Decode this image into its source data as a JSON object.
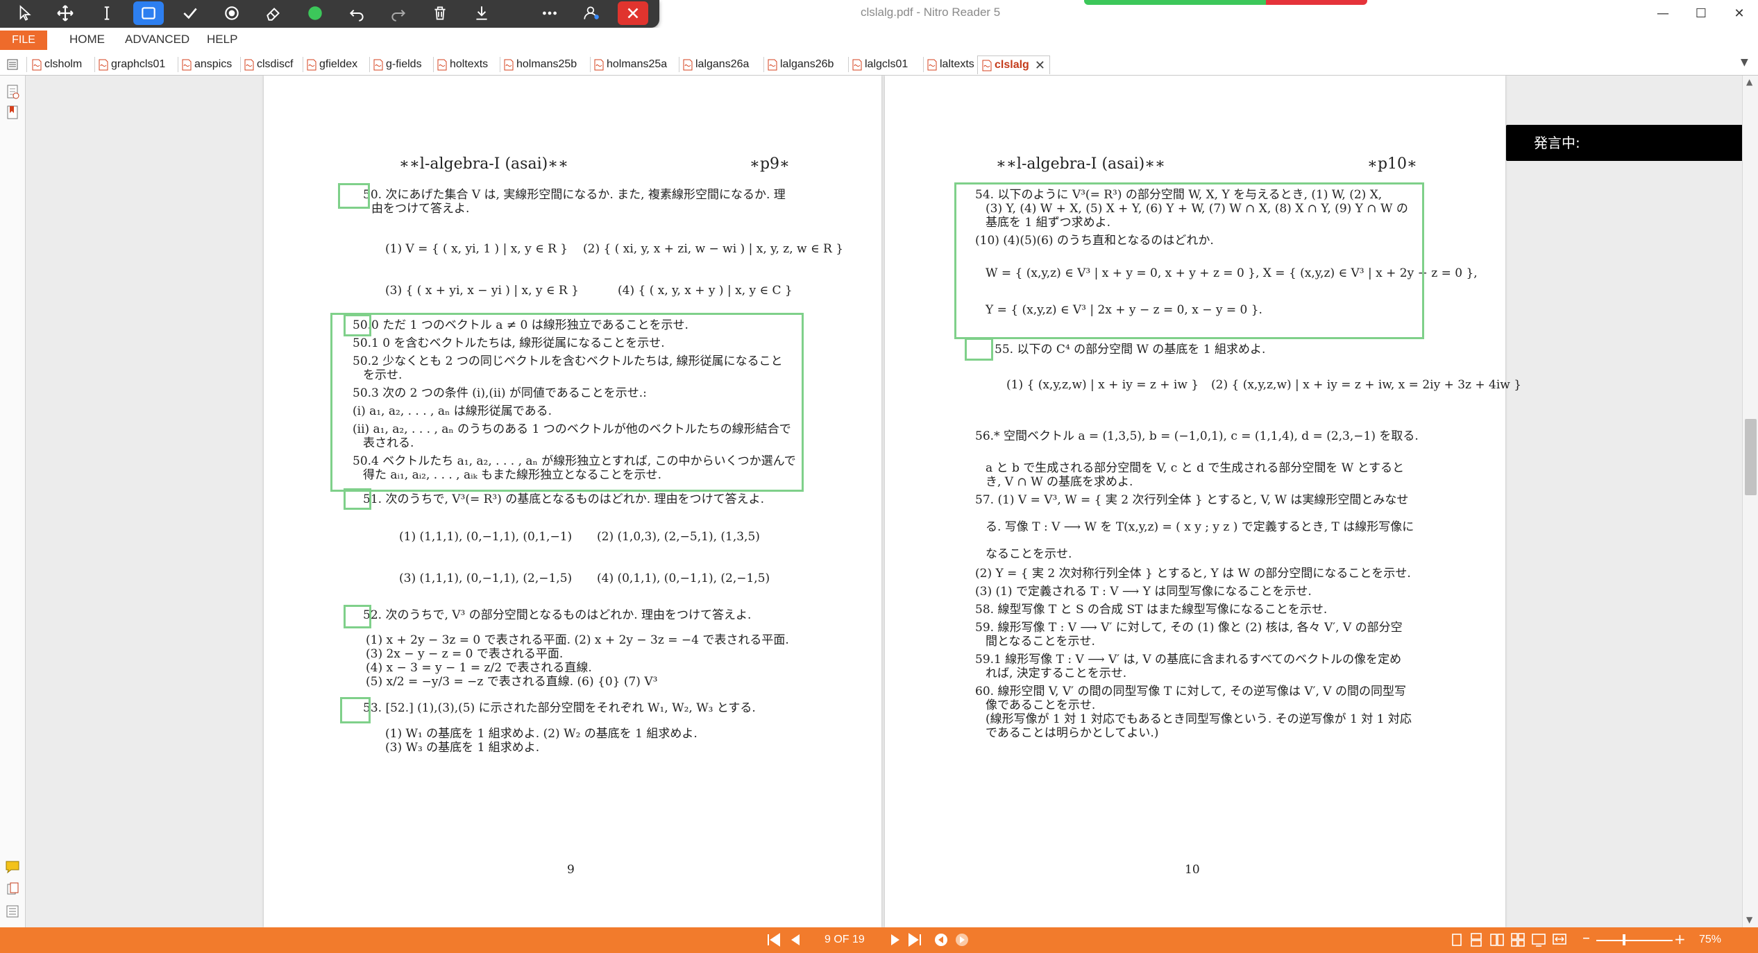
{
  "app": {
    "title": "clslalg.pdf - Nitro Reader 5"
  },
  "window": {
    "minimize": "—",
    "maximize": "☐",
    "close": "✕"
  },
  "ribbon": {
    "file": "FILE",
    "home": "HOME",
    "advanced": "ADVANCED",
    "help": "HELP"
  },
  "tabs": [
    "clsholm",
    "graphcls01",
    "anspics",
    "clsdiscf",
    "gfieldex",
    "g-fields",
    "holtexts",
    "holmans25b",
    "holmans25a",
    "lalgans26a",
    "lalgans26b",
    "lalgcls01",
    "laltexts",
    "clslalg"
  ],
  "tooltip": {
    "text": "発言中:"
  },
  "status": {
    "page_counter": "9 OF 19",
    "zoom": "75%"
  },
  "page9": {
    "header_left": "∗∗l-algebra-I (asai)∗∗",
    "header_right": "∗p9∗",
    "footer": "9",
    "lines": [
      "50. 次にあげた集合 V は, 実線形空間になるか. また, 複素線形空間になるか. 理",
      "由をつけて答えよ.",
      "(1) V = { ( x, yi, 1 ) | x, y ∈ R }",
      "(2) { ( xi, y, x + zi, w − wi ) | x, y, z, w ∈ R }",
      "(3) { ( x + yi, x − yi ) | x, y ∈ R }",
      "(4) { ( x, y, x + y ) | x, y ∈ C }",
      "50.0 ただ 1 つのベクトル a ≠ 0 は線形独立であることを示せ.",
      "50.1 0 を含むベクトルたちは, 線形従属になることを示せ.",
      "50.2 少なくとも 2 つの同じベクトルを含むベクトルたちは, 線形従属になること",
      "を示せ.",
      "50.3 次の 2 つの条件 (i),(ii) が同値であることを示せ.:",
      "(i) a₁, a₂, . . . , aₙ は線形従属である.",
      "(ii) a₁, a₂, . . . , aₙ のうちのある 1 つのベクトルが他のベクトルたちの線形結合で",
      "表される.",
      "50.4 ベクトルたち a₁, a₂, . . . , aₙ が線形独立とすれば, この中からいくつか選んで",
      "得た aᵢ₁, aᵢ₂, . . . , aᵢₖ もまた線形独立となることを示せ.",
      "51. 次のうちで, V³(= R³) の基底となるものはどれか. 理由をつけて答えよ.",
      "(1) (1,1,1), (0,−1,1), (0,1,−1)",
      "(2) (1,0,3), (2,−5,1), (1,3,5)",
      "(3) (1,1,1), (0,−1,1), (2,−1,5)",
      "(4) (0,1,1), (0,−1,1), (2,−1,5)",
      "52. 次のうちで, V³ の部分空間となるものはどれか. 理由をつけて答えよ.",
      "(1) x + 2y − 3z = 0 で表される平面.   (2) x + 2y − 3z = −4 で表される平面.",
      "(3) 2x − y − z = 0 で表される平面.",
      "(4) x − 3 = y − 1 = z/2 で表される直線.",
      "(5) x/2 = −y/3 = −z で表される直線.      (6) {0}      (7) V³",
      "53. [52.] (1),(3),(5) に示された部分空間をそれぞれ W₁, W₂, W₃ とする.",
      "(1) W₁ の基底を 1 組求めよ.                              (2) W₂ の基底を 1 組求めよ.",
      "(3) W₃ の基底を 1 組求めよ."
    ]
  },
  "page10": {
    "header_left": "∗∗l-algebra-I (asai)∗∗",
    "header_right": "∗p10∗",
    "footer": "10",
    "lines": [
      "54. 以下のように V³(= R³) の部分空間 W, X, Y を与えるとき, (1) W, (2) X,",
      "(3) Y, (4) W + X, (5) X + Y, (6) Y + W, (7) W ∩ X, (8) X ∩ Y, (9) Y ∩ W の",
      "基底を 1 組ずつ求めよ.",
      "(10) (4)(5)(6) のうち直和となるのはどれか.",
      "W = { (x,y,z) ∈ V³ | x + y = 0, x + y + z = 0 },  X = { (x,y,z) ∈ V³ | x + 2y − z = 0 },",
      "Y = { (x,y,z) ∈ V³ | 2x + y − z = 0, x − y = 0 }.",
      "55. 以下の C⁴ の部分空間 W の基底を 1 組求めよ.",
      "(1) { (x,y,z,w) | x + iy = z + iw }",
      "(2) { (x,y,z,w) | x + iy = z + iw, x = 2iy + 3z + 4iw }",
      "56.* 空間ベクトル a = (1,3,5), b = (−1,0,1), c = (1,1,4), d = (2,3,−1) を取る.",
      "a と b で生成される部分空間を V, c と d で生成される部分空間を W とすると",
      "き, V ∩ W の基底を求めよ.",
      "57. (1) V = V³, W = { 実 2 次行列全体 } とすると, V, W は実線形空間とみなせ",
      "る. 写像 T : V ⟶ W を T(x,y,z) = ( x y ; y z ) で定義するとき, T は線形写像に",
      "なることを示せ.",
      "(2) Y = { 実 2 次対称行列全体 } とすると, Y は W の部分空間になることを示せ.",
      "(3) (1) で定義される T : V ⟶ Y は同型写像になることを示せ.",
      "58. 線型写像 T と S の合成 ST はまた線型写像になることを示せ.",
      "59. 線形写像 T : V ⟶ V′ に対して, その (1) 像と (2) 核は, 各々 V′, V の部分空",
      "間となることを示せ.",
      "59.1 線形写像 T : V ⟶ V′ は, V の基底に含まれるすべてのベクトルの像を定め",
      "れば, 決定することを示せ.",
      "60. 線形空間 V, V′ の間の同型写像 T に対して, その逆写像は V′, V の間の同型写",
      "像であることを示せ.",
      "(線形写像が 1 対 1 対応でもあるとき同型写像という. その逆写像が 1 対 1 対応",
      "であることは明らかとしてよい.)"
    ]
  }
}
